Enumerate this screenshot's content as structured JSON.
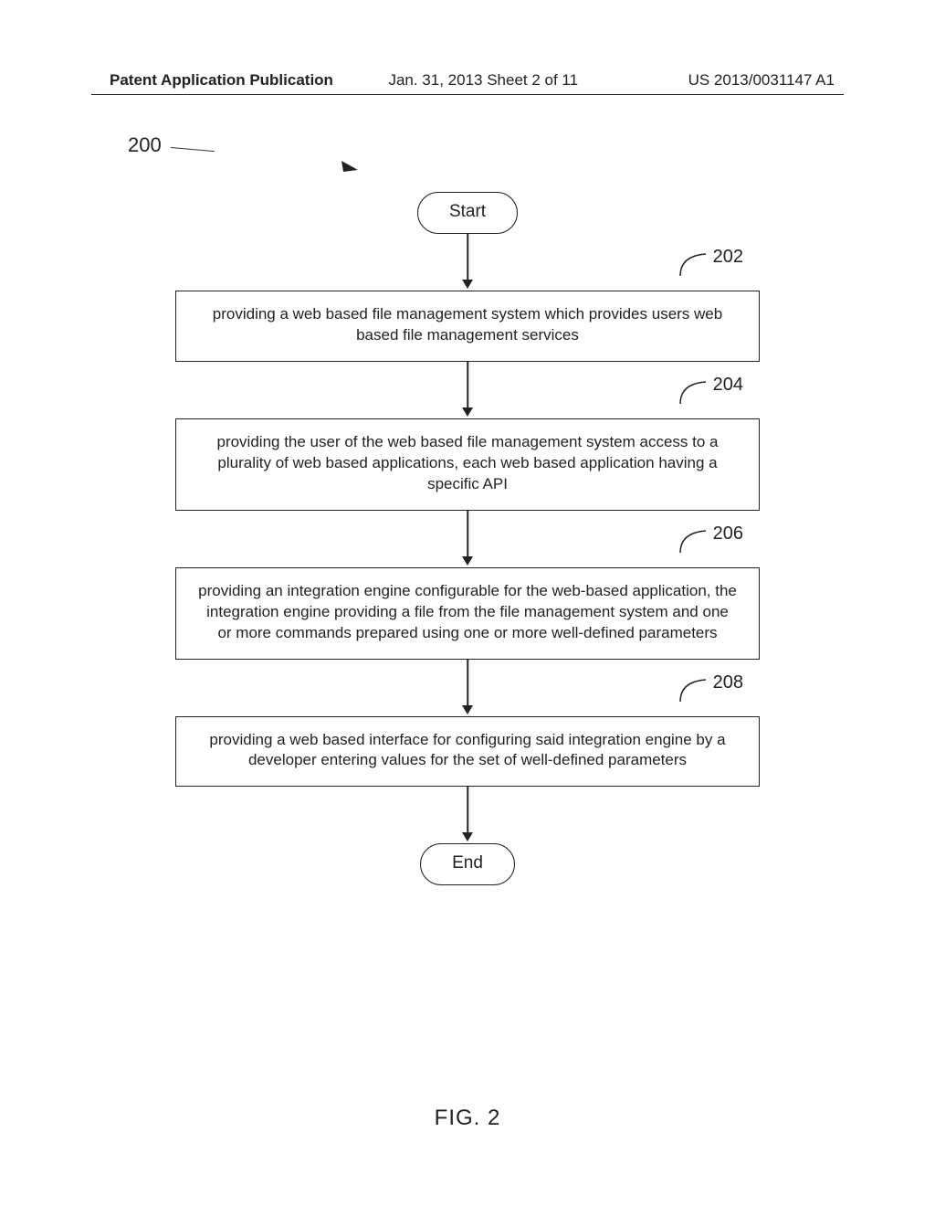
{
  "header": {
    "left": "Patent Application Publication",
    "mid": "Jan. 31, 2013  Sheet 2 of 11",
    "right": "US 2013/0031147 A1"
  },
  "diagram": {
    "ref": "200",
    "start": "Start",
    "end": "End",
    "steps": [
      {
        "num": "202",
        "text": "providing a web based file management system which provides users web based file management services"
      },
      {
        "num": "204",
        "text": "providing the user of the web based file management system access to a plurality of web based applications, each web based application having a specific API"
      },
      {
        "num": "206",
        "text": "providing an integration engine configurable for the web-based application, the integration engine providing a file from the file management system and one or more commands prepared using one or more well-defined parameters"
      },
      {
        "num": "208",
        "text": "providing a web based interface for configuring said integration engine by a developer entering values for the set of well-defined parameters"
      }
    ],
    "figure_label": "FIG. 2"
  }
}
